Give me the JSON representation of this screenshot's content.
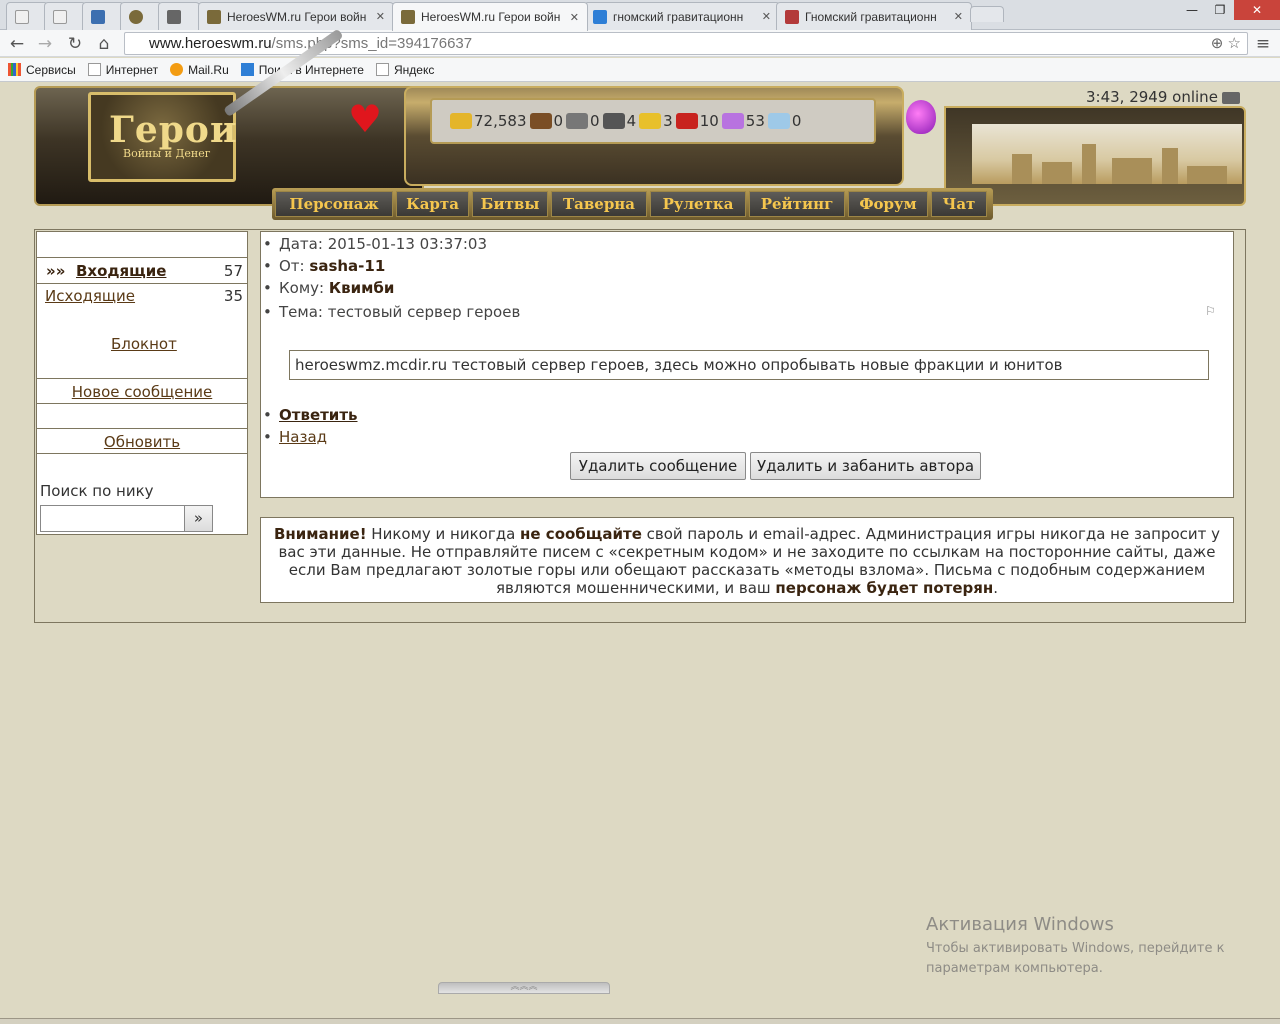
{
  "browser": {
    "tabs": [
      {
        "title": "",
        "icon_color": "#e8e8e8"
      },
      {
        "title": "",
        "icon_color": "#e8e8e8"
      },
      {
        "title": "",
        "icon_color": "#3c6fb0"
      },
      {
        "title": "",
        "icon_color": "#7a6a3a"
      },
      {
        "title": "",
        "icon_color": "#666666"
      },
      {
        "title": "HeroesWM.ru Герои войн",
        "icon_color": "#7a6a3a"
      },
      {
        "title": "HeroesWM.ru Герои войн",
        "icon_color": "#7a6a3a"
      },
      {
        "title": "гномский гравитационн",
        "icon_color": "#2f7fd6"
      },
      {
        "title": "Гномский гравитационн",
        "icon_color": "#b33a3a"
      }
    ],
    "url_host": "www.heroeswm.ru",
    "url_path": "/sms.php?sms_id=394176637",
    "bookmarks": [
      "Сервисы",
      "Интернет",
      "Mail.Ru",
      "Поиск в Интернете",
      "Яндекс"
    ],
    "back_icon": "back-arrow-icon",
    "forward_icon": "forward-arrow-icon",
    "reload_icon": "reload-icon",
    "home_icon": "home-icon"
  },
  "game": {
    "logo_title": "Герои",
    "logo_subtitle": "Войны и Денег",
    "clock": "3:43, 2949 online",
    "resources": [
      {
        "name": "gold",
        "value": "72,583",
        "color": "#e4b52a"
      },
      {
        "name": "wood",
        "value": "0",
        "color": "#7a4e25"
      },
      {
        "name": "ore",
        "value": "0",
        "color": "#777777"
      },
      {
        "name": "mercury",
        "value": "4",
        "color": "#555555"
      },
      {
        "name": "sulfur",
        "value": "3",
        "color": "#e8c02a"
      },
      {
        "name": "crystals",
        "value": "10",
        "color": "#c8231e"
      },
      {
        "name": "gems",
        "value": "53",
        "color": "#b873e0"
      },
      {
        "name": "diamonds",
        "value": "0",
        "color": "#9ec9e8"
      }
    ],
    "menu": [
      "Персонаж",
      "Карта",
      "Битвы",
      "Таверна",
      "Рулетка",
      "Рейтинг",
      "Форум",
      "Чат"
    ]
  },
  "sidebar": {
    "inbox_arrows": "»»",
    "inbox_label": "Входящие",
    "inbox_count": "57",
    "outbox_label": "Исходящие",
    "outbox_count": "35",
    "notepad_label": "Блокнот",
    "new_message_label": "Новое сообщение",
    "refresh_label": "Обновить",
    "search_label": "Поиск по нику",
    "search_button": "»"
  },
  "message": {
    "date_label": "Дата:",
    "date_value": "2015-01-13 03:37:03",
    "from_label": "От:",
    "from_value": "sasha-11",
    "to_label": "Кому:",
    "to_value": "Квимби",
    "subject_label": "Тема:",
    "subject_value": "тестовый сервер героев",
    "body": "heroeswmz.mcdir.ru тестовый сервер героев, здесь можно опробывать новые фракции и юнитов",
    "reply_label": "Ответить",
    "back_label": "Назад",
    "delete_button": "Удалить сообщение",
    "delete_ban_button": "Удалить и забанить автора"
  },
  "warning": {
    "p1": "Внимание!",
    "p2": " Никому и никогда ",
    "p3": "не сообщайте",
    "p4": " свой пароль и email-адрес. Администрация игры никогда не запросит у вас эти данные. Не отправляйте писем с «секретным кодом» и не заходите по ссылкам на посторонние сайты, даже если Вам предлагают золотые горы или обещают рассказать «методы взлома». Письма с подобным содержанием являются мошенническими, и ваш ",
    "p5": "персонаж будет потерян",
    "p6": "."
  },
  "os": {
    "activation_title": "Активация Windows",
    "activation_text": "Чтобы активировать Windows, перейдите к параметрам компьютера."
  }
}
